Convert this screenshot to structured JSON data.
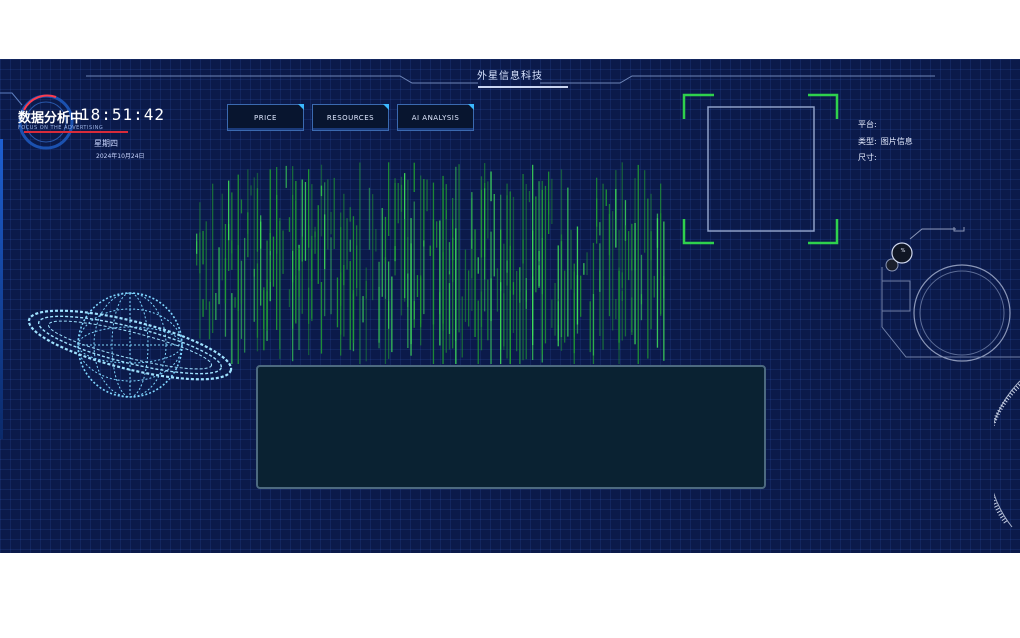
{
  "header": {
    "title": "外星信息科技"
  },
  "clock": {
    "title": "数据分析中",
    "time": "18:51:42",
    "subtitle": "FOCUS ON THE ADVERTISING",
    "weekday": "星期四",
    "date": "2024年10月24日"
  },
  "tabs": [
    {
      "label": "PRICE"
    },
    {
      "label": "RESOURCES"
    },
    {
      "label": "AI ANALYSIS"
    }
  ],
  "info": {
    "platform_label": "平台:",
    "platform_value": "",
    "type_label": "类型:",
    "type_value": "图片信息",
    "size_label": "尺寸:",
    "size_value": ""
  },
  "gauge": {
    "value_label": "%"
  },
  "colors": {
    "background": "#0b1a4a",
    "accent_green": "#2fd14d",
    "matrix_green": "#28b83a",
    "globe_cyan": "#7fd6ff",
    "alert_red": "#d82b3a"
  }
}
